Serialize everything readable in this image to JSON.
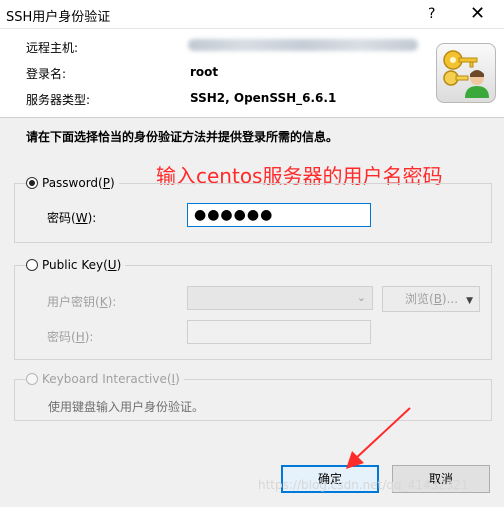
{
  "window": {
    "title": "SSH用户身份验证",
    "help_label": "?",
    "close_label": "✕"
  },
  "info": {
    "remote_host_label": "远程主机:",
    "username_label": "登录名:",
    "username_value": "root",
    "server_type_label": "服务器类型:",
    "server_type_value": "SSH2, OpenSSH_6.6.1",
    "icon": "keys-user-icon"
  },
  "instruction": "请在下面选择恰当的身份验证方法并提供登录所需的信息。",
  "annotation": "输入centos服务器的用户名密码",
  "password_section": {
    "radio_text": "Password(",
    "radio_key": "P",
    "radio_end": ")",
    "selected": true,
    "field_label": "密码(",
    "field_key": "W",
    "field_end": "):",
    "field_value": "●●●●●●"
  },
  "pubkey_section": {
    "radio_text": "Public Key(",
    "radio_key": "U",
    "radio_end": ")",
    "user_key_label": "用户密钥(",
    "user_key_key": "K",
    "user_key_end": "):",
    "browse_label": "浏览(",
    "browse_key": "B",
    "browse_end": ")...",
    "passphrase_label": "密码(",
    "passphrase_key": "H",
    "passphrase_end": "):"
  },
  "keyboard_section": {
    "radio_text": "Keyboard Interactive(",
    "radio_key": "I",
    "radio_end": ")",
    "note": "使用键盘输入用户身份验证。"
  },
  "buttons": {
    "ok": "确定",
    "cancel": "取消"
  },
  "watermark": "https://blog.csdn.net/qq_41432321",
  "colors": {
    "accent": "#0078d7",
    "annotation": "#ff2a2a"
  }
}
